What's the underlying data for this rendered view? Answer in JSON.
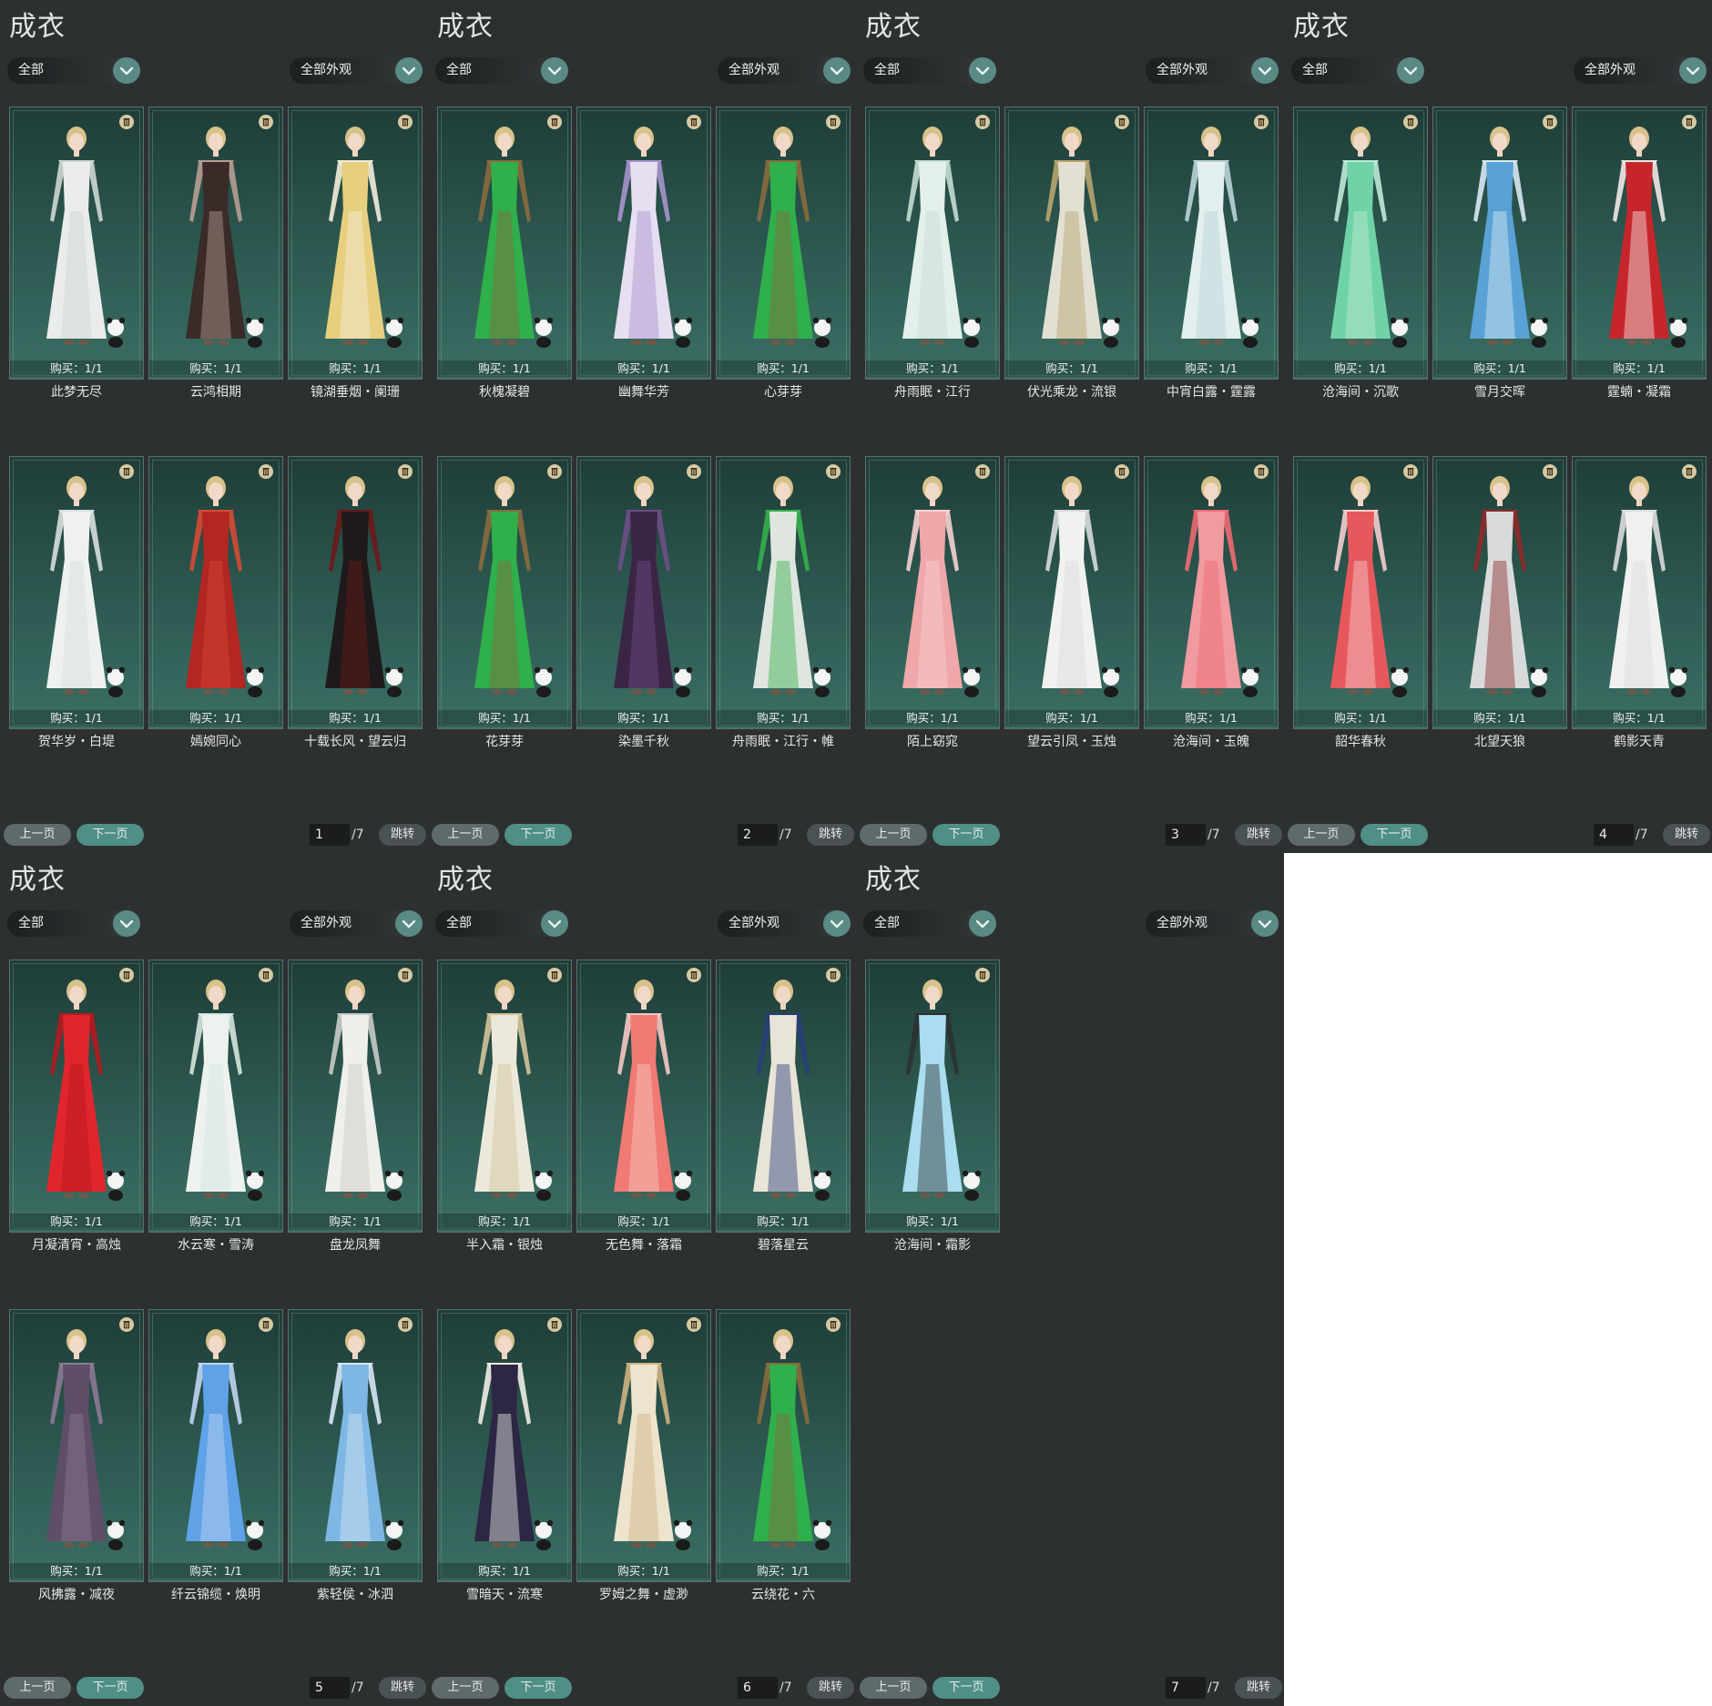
{
  "panels": [
    {
      "title": "成衣",
      "filter_left": "全部",
      "filter_right": "全部外观",
      "items": [
        {
          "name": "此梦无尽",
          "buy": "购买：1/1",
          "colors": [
            "#e9ecea",
            "#cfd7d3"
          ]
        },
        {
          "name": "云鸿相期",
          "buy": "购买：1/1",
          "colors": [
            "#3a2b29",
            "#b79e95"
          ]
        },
        {
          "name": "镜湖垂烟・阑珊",
          "buy": "购买：1/1",
          "colors": [
            "#e7cf7f",
            "#f3ecd9"
          ]
        },
        {
          "name": "贺华岁・白堤",
          "buy": "购买：1/1",
          "colors": [
            "#eef1f0",
            "#d8dfdd"
          ]
        },
        {
          "name": "嫣婉同心",
          "buy": "购买：1/1",
          "colors": [
            "#b32621",
            "#d64a35"
          ]
        },
        {
          "name": "十载长风・望云归",
          "buy": "购买：1/1",
          "colors": [
            "#1e1a1b",
            "#6b1919"
          ]
        }
      ],
      "page": "1",
      "total": "/7"
    },
    {
      "title": "成衣",
      "filter_left": "全部",
      "filter_right": "全部外观",
      "items": [
        {
          "name": "秋槐凝碧",
          "buy": "购买：1/1",
          "colors": [
            "#2fb04a",
            "#8a6a3e"
          ]
        },
        {
          "name": "幽舞华芳",
          "buy": "购买：1/1",
          "colors": [
            "#e7def2",
            "#a793cc"
          ]
        },
        {
          "name": "心芽芽",
          "buy": "购买：1/1",
          "colors": [
            "#2fb04a",
            "#8a6a3e"
          ]
        },
        {
          "name": "花芽芽",
          "buy": "购买：1/1",
          "colors": [
            "#2fb04a",
            "#8a6a3e"
          ]
        },
        {
          "name": "染墨千秋",
          "buy": "购买：1/1",
          "colors": [
            "#3b2545",
            "#6f4e88"
          ]
        },
        {
          "name": "舟雨眠・江行・帷",
          "buy": "购买：1/1",
          "colors": [
            "#dfe6df",
            "#35b04a"
          ]
        }
      ],
      "page": "2",
      "total": "/7"
    },
    {
      "title": "成衣",
      "filter_left": "全部",
      "filter_right": "全部外观",
      "items": [
        {
          "name": "舟雨眠・江行",
          "buy": "购买：1/1",
          "colors": [
            "#e3efe9",
            "#c4ddd2"
          ]
        },
        {
          "name": "伏光乘龙・流银",
          "buy": "购买：1/1",
          "colors": [
            "#e2e0d3",
            "#b8a56e"
          ]
        },
        {
          "name": "中宵白露・霆露",
          "buy": "购买：1/1",
          "colors": [
            "#e3eeee",
            "#b9d5d7"
          ]
        },
        {
          "name": "陌上窈窕",
          "buy": "购买：1/1",
          "colors": [
            "#f0a7a9",
            "#f6d3d2"
          ]
        },
        {
          "name": "望云引凤・玉烛",
          "buy": "购买：1/1",
          "colors": [
            "#f1f2f0",
            "#d8dcda"
          ]
        },
        {
          "name": "沧海间・玉魄",
          "buy": "购买：1/1",
          "colors": [
            "#f19aa0",
            "#ef6a72"
          ]
        }
      ],
      "page": "3",
      "total": "/7"
    },
    {
      "title": "成衣",
      "filter_left": "全部",
      "filter_right": "全部外观",
      "items": [
        {
          "name": "沧海间・沉歌",
          "buy": "购买：1/1",
          "colors": [
            "#6fd3a7",
            "#bfe9d8"
          ]
        },
        {
          "name": "雪月交晖",
          "buy": "购买：1/1",
          "colors": [
            "#5aa2d5",
            "#d9e8f1"
          ]
        },
        {
          "name": "霆蝻・凝霜",
          "buy": "购买：1/1",
          "colors": [
            "#c6262b",
            "#f1e9e6"
          ]
        },
        {
          "name": "韶华春秋",
          "buy": "购买：1/1",
          "colors": [
            "#e7585c",
            "#f3cfcf"
          ]
        },
        {
          "name": "北望天狼",
          "buy": "购买：1/1",
          "colors": [
            "#d9dadb",
            "#8e2a2a"
          ]
        },
        {
          "name": "鹤影天青",
          "buy": "购买：1/1",
          "colors": [
            "#f0f0ef",
            "#dcdcdc"
          ]
        }
      ],
      "page": "4",
      "total": "/7"
    },
    {
      "title": "成衣",
      "filter_left": "全部",
      "filter_right": "全部外观",
      "items": [
        {
          "name": "月凝清宵・高烛",
          "buy": "购买：1/1",
          "colors": [
            "#e0262c",
            "#b3191e"
          ]
        },
        {
          "name": "水云寒・雪涛",
          "buy": "购买：1/1",
          "colors": [
            "#edf2ee",
            "#d5e4dd"
          ]
        },
        {
          "name": "盘龙凤舞",
          "buy": "购买：1/1",
          "colors": [
            "#efefec",
            "#c9cbc6"
          ]
        },
        {
          "name": "风拂露・减夜",
          "buy": "购买：1/1",
          "colors": [
            "#5f4e68",
            "#8b7a94"
          ]
        },
        {
          "name": "纤云锦缆・焕明",
          "buy": "购买：1/1",
          "colors": [
            "#5fa2e8",
            "#c1d4ef"
          ]
        },
        {
          "name": "紫轻侯・冰泗",
          "buy": "购买：1/1",
          "colors": [
            "#7fb7e4",
            "#d6e7f4"
          ]
        }
      ],
      "page": "5",
      "total": "/7"
    },
    {
      "title": "成衣",
      "filter_left": "全部",
      "filter_right": "全部外观",
      "items": [
        {
          "name": "半入霜・银烛",
          "buy": "购买：1/1",
          "colors": [
            "#ece9da",
            "#d2c49a"
          ]
        },
        {
          "name": "无色舞・落霜",
          "buy": "购买：1/1",
          "colors": [
            "#f07a74",
            "#f6c9c3"
          ]
        },
        {
          "name": "碧落星云",
          "buy": "购买：1/1",
          "colors": [
            "#e9e4d8",
            "#283e78"
          ]
        },
        {
          "name": "雪暗天・流寒",
          "buy": "购买：1/1",
          "colors": [
            "#2d2644",
            "#f0ede4"
          ]
        },
        {
          "name": "罗姆之舞・虚渺",
          "buy": "购买：1/1",
          "colors": [
            "#eee4cd",
            "#cdb283"
          ]
        },
        {
          "name": "云绕花・六",
          "buy": "购买：1/1",
          "colors": [
            "#2fb04a",
            "#8a6a3e"
          ]
        }
      ],
      "page": "6",
      "total": "/7"
    },
    {
      "title": "成衣",
      "filter_left": "全部",
      "filter_right": "全部外观",
      "items": [
        {
          "name": "沧海间・霜影",
          "buy": "购买：1/1",
          "colors": [
            "#a9ddef",
            "#2c3131"
          ]
        }
      ],
      "page": "7",
      "total": "/7"
    }
  ],
  "pager": {
    "prev": "上一页",
    "next": "下一页",
    "jump": "跳转"
  }
}
